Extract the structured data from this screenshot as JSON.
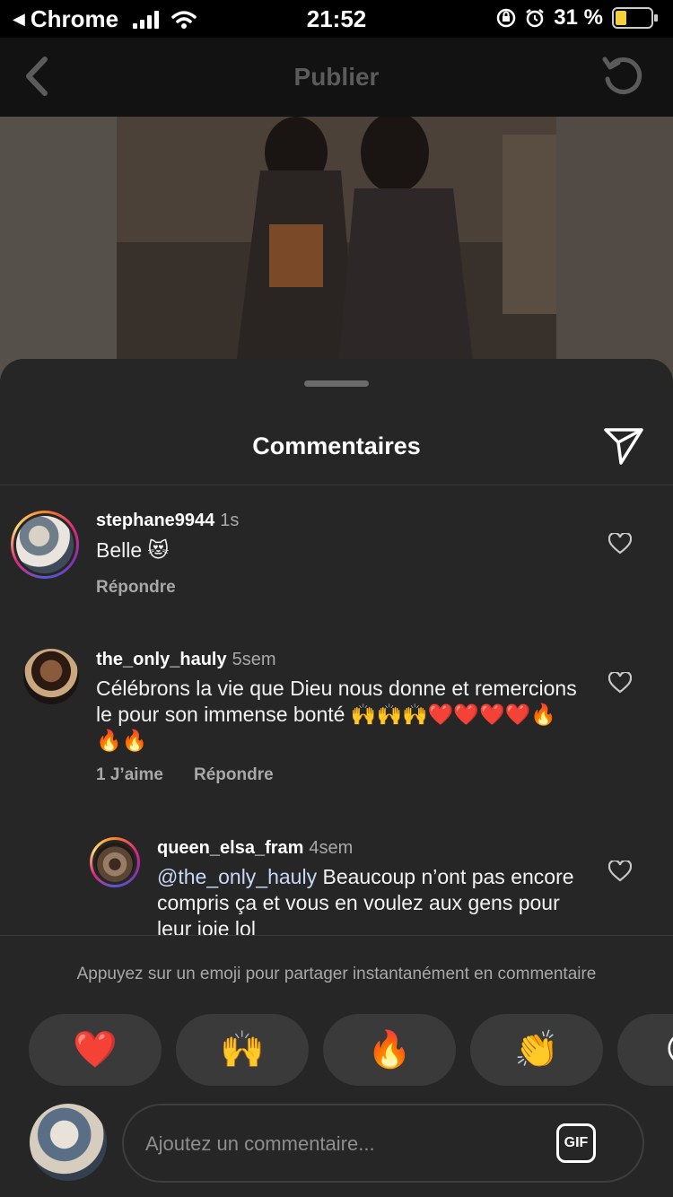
{
  "status_bar": {
    "back_app": "Chrome",
    "time": "21:52",
    "battery": "31 %",
    "battery_level": 0.31
  },
  "header": {
    "title": "Publier"
  },
  "sheet": {
    "title": "Commentaires"
  },
  "comments": [
    {
      "username": "stephane9944",
      "time": "1s",
      "text": "Belle 😻",
      "reply_label": "Répondre"
    },
    {
      "username": "the_only_hauly",
      "time": "5sem",
      "text": "Célébrons la vie que Dieu nous donne et remercions le pour son immense bonté 🙌🙌🙌❤️❤️❤️❤️🔥🔥🔥",
      "likes_label": "1 J’aime",
      "reply_label": "Répondre"
    },
    {
      "username": "queen_elsa_fram",
      "time": "4sem",
      "mention": "@the_only_hauly",
      "text": " Beaucoup n’ont pas encore compris ça et vous en voulez aux gens pour leur joie lol"
    }
  ],
  "emoji_hint": "Appuyez sur un emoji pour partager instantanément en commentaire",
  "emoji_bar": [
    "❤️",
    "🙌",
    "🔥",
    "👏",
    "😢"
  ],
  "composer": {
    "placeholder": "Ajoutez un commentaire...",
    "gif_label": "GIF"
  }
}
